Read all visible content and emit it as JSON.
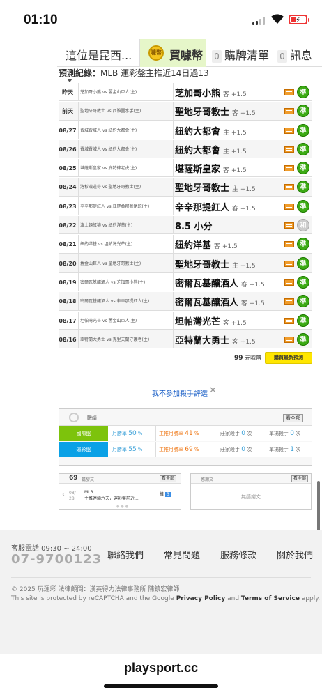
{
  "status_bar": {
    "time": "01:10"
  },
  "top_nav": {
    "title": "這位是昆西...",
    "buy_label": "買噱幣",
    "coin_icon_text": "噱幣",
    "cart_count": "0",
    "cart_label": "購牌清單",
    "msg_count": "0",
    "msg_label": "訊息"
  },
  "record": {
    "title_bold": "預測紀錄：",
    "title_rest": "MLB 運彩盤主推近14日過13",
    "rows": [
      {
        "date": "昨天",
        "match": "芝加哥小熊 vs 舊金山巨人(主)",
        "pick": "芝加哥小熊",
        "side": "客 +1.5",
        "result": "準"
      },
      {
        "date": "前天",
        "match": "聖地牙哥教士 vs 西雅圖水手(主)",
        "pick": "聖地牙哥教士",
        "side": "客 +1.5",
        "result": "準"
      },
      {
        "date": "08/27",
        "match": "費城費城人 vs 紐約大都會(主)",
        "pick": "紐約大都會",
        "side": "主 +1.5",
        "result": "準"
      },
      {
        "date": "08/26",
        "match": "費城費城人 vs 紐約大都會(主)",
        "pick": "紐約大都會",
        "side": "主 +1.5",
        "result": "準"
      },
      {
        "date": "08/25",
        "match": "堪薩斯皇家 vs 底特律老虎(主)",
        "pick": "堪薩斯皇家",
        "side": "客 +1.5",
        "result": "準"
      },
      {
        "date": "08/24",
        "match": "洛杉磯道奇 vs 聖地牙哥教士(主)",
        "pick": "聖地牙哥教士",
        "side": "主 +1.5",
        "result": "準"
      },
      {
        "date": "08/23",
        "match": "辛辛那提紅人 vs 亞歷桑那響尾蛇(主)",
        "pick": "辛辛那提紅人",
        "side": "客 +1.5",
        "result": "準"
      },
      {
        "date": "08/22",
        "match": "波士頓紅襪 vs 紐約洋基(主)",
        "pick": "8.5 小分",
        "side": "",
        "result": "和"
      },
      {
        "date": "08/21",
        "match": "紐約洋基 vs 坦帕灣光芒(主)",
        "pick": "紐約洋基",
        "side": "客 +1.5",
        "result": "準"
      },
      {
        "date": "08/20",
        "match": "舊金山巨人 vs 聖地牙哥教士(主)",
        "pick": "聖地牙哥教士",
        "side": "主 −1.5",
        "result": "準"
      },
      {
        "date": "08/19",
        "match": "密爾瓦基釀酒人 vs 芝加哥小熊(主)",
        "pick": "密爾瓦基釀酒人",
        "side": "客 +1.5",
        "result": "準"
      },
      {
        "date": "08/18",
        "match": "密爾瓦基釀酒人 vs 辛辛那提紅人(主)",
        "pick": "密爾瓦基釀酒人",
        "side": "客 +1.5",
        "result": "準"
      },
      {
        "date": "08/17",
        "match": "坦帕灣光芒 vs 舊金山巨人(主)",
        "pick": "坦帕灣光芒",
        "side": "客 +1.5",
        "result": "準"
      },
      {
        "date": "08/16",
        "match": "亞特蘭大勇士 vs 克里夫蘭守護者(主)",
        "pick": "亞特蘭大勇士",
        "side": "客 +1.5",
        "result": "準"
      }
    ],
    "coins_amount": "99",
    "coins_unit": "元噱幣",
    "buy_latest": "購買最新預測"
  },
  "optout_text": "我不參加殺手評選",
  "stats": {
    "title": "戰績",
    "all_label": "看全部",
    "rows": [
      {
        "tag": "國際盤",
        "month_label": "月勝率",
        "month_value": "50",
        "main_label": "主推月勝率",
        "main_value": "41",
        "killer_label": "莊家殺手",
        "killer_value": "0",
        "single_label": "單場殺手",
        "single_value": "0",
        "unit": "次"
      },
      {
        "tag": "運彩盤",
        "month_label": "月勝率",
        "month_value": "55",
        "main_label": "主推月勝率",
        "main_value": "69",
        "killer_label": "莊家殺手",
        "killer_value": "0",
        "single_label": "單場殺手",
        "single_value": "1",
        "unit": "次"
      }
    ]
  },
  "posts": {
    "count": "69",
    "label": "篇發文",
    "all_label": "看全部",
    "date_top": "08/",
    "date_bottom": "28",
    "league": "MLB：",
    "preview": "主推連續六天，運彩盤前近...",
    "push_label": "推",
    "push_count": "3"
  },
  "thanks": {
    "label": "感謝文",
    "all_label": "看全部",
    "empty": "無感謝文"
  },
  "footer": {
    "hotline_label": "客服電話 09:30 ~ 24:00",
    "hotline": "07-9700123",
    "links": [
      "聯絡我們",
      "常見問題",
      "服務條款",
      "關於我們"
    ],
    "copyright": "© 2025 玩運彩 法律顧問：漢英得力法律事務所 陳鎮宏律師",
    "recaptcha_pre": "This site is protected by reCAPTCHA and the Google",
    "privacy": "Privacy Policy",
    "and": "and",
    "terms": "Terms of Service",
    "apply": "apply."
  },
  "browser": {
    "url": "playsport.cc"
  },
  "colors": {
    "green": "#3caa14",
    "intl_tag": "#7dc30c",
    "sports_tag": "#0aa1e6",
    "buy_yellow": "#ffe600",
    "link_blue": "#1a5fc7"
  }
}
